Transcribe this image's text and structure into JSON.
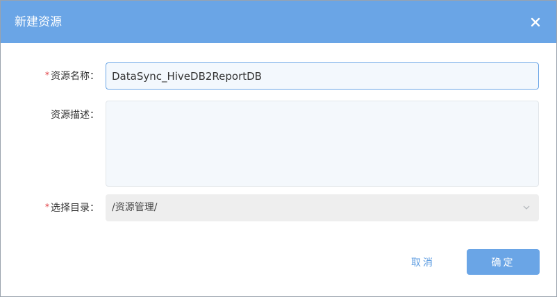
{
  "dialog": {
    "title": "新建资源",
    "close_icon": "close-icon"
  },
  "form": {
    "required_mark": "*",
    "name": {
      "label": "资源名称：",
      "value": "DataSync_HiveDB2ReportDB",
      "required": true
    },
    "description": {
      "label": "资源描述：",
      "value": "",
      "required": false
    },
    "directory": {
      "label": "选择目录：",
      "value": "/资源管理/",
      "required": true,
      "dropdown_icon": "chevron-down-icon"
    }
  },
  "footer": {
    "cancel_label": "取消",
    "ok_label": "确定"
  },
  "colors": {
    "accent": "#6aa5e6",
    "required": "#e0393e",
    "cancel_text": "#5b9be0"
  }
}
